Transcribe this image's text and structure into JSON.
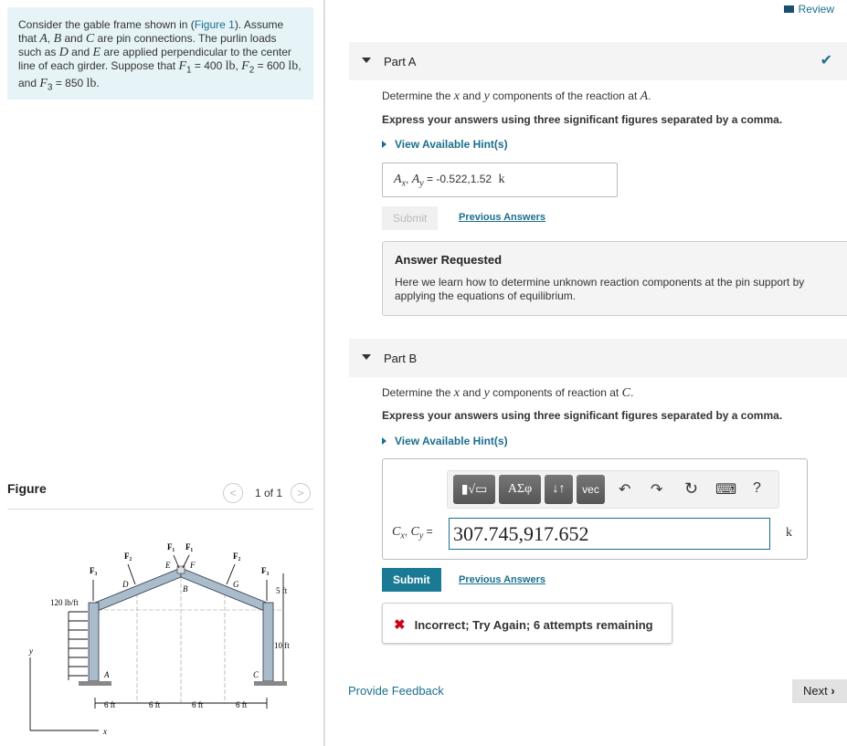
{
  "review": "Review",
  "problem": {
    "p1": "Consider the gable frame shown in (",
    "fig_link": "Figure 1",
    "p2": "). Assume that ",
    "A": "A",
    "B": "B",
    "C": "C",
    "p3": " are pin connections. The purlin loads such as ",
    "D": "D",
    "E": "E",
    "p4": " are applied perpendicular to the center line of each girder. Suppose that ",
    "F1": "F",
    "F1sub": "1",
    "F1val": " = 400 ",
    "unit": "lb",
    "F2": "F",
    "F2sub": "2",
    "F2val": " = 600 ",
    "F3": "F",
    "F3sub": "3",
    "F3val": " = 850 ",
    "and": " and ",
    "comma": ", ",
    "comma_and": ", and "
  },
  "figure": {
    "heading": "Figure",
    "pager": "1 of 1",
    "load": "120 lb/ft",
    "dims": [
      "6 ft",
      "6 ft",
      "6 ft",
      "6 ft"
    ],
    "h1": "5 ft",
    "h2": "10 ft",
    "labels": {
      "A": "A",
      "B": "B",
      "C": "C",
      "D": "D",
      "E": "E",
      "F": "F",
      "G": "G",
      "F1": "F₁",
      "F2": "F₂",
      "F3": "F₃",
      "x": "x",
      "y": "y"
    }
  },
  "partA": {
    "title": "Part A",
    "question_pre": "Determine the ",
    "x": "x",
    "and": " and ",
    "y": "y",
    "question_post": " components of the reaction at ",
    "point": "A",
    "instructions": "Express your answers using three significant figures separated by a comma.",
    "hint": "View Available Hint(s)",
    "answer_label": "A",
    "answer_label2": "A",
    "answer_value": "-0.522,1.52",
    "answer_unit": "k",
    "submit": "Submit",
    "previous": "Previous Answers",
    "requested_title": "Answer Requested",
    "requested_text": "Here we learn how to determine unknown reaction components at the pin support by applying the equations of equilibrium."
  },
  "partB": {
    "title": "Part B",
    "question_pre": "Determine the ",
    "x": "x",
    "and": " and ",
    "y": "y",
    "question_post": " components of reaction at ",
    "point": "C",
    "instructions": "Express your answers using three significant figures separated by a comma.",
    "hint": "View Available Hint(s)",
    "toolbar": {
      "templates": "▮√▭",
      "greek": "ΑΣφ",
      "sort": "↓↑",
      "vec": "vec",
      "undo": "↶",
      "redo": "↷",
      "reset": "↻",
      "keyboard": "⌨",
      "help": "?"
    },
    "answer_label": "C",
    "answer_value": "307.745,917.652",
    "answer_unit": "k",
    "submit": "Submit",
    "previous": "Previous Answers",
    "feedback": "Incorrect; Try Again; 6 attempts remaining"
  },
  "footer": {
    "provide_feedback": "Provide Feedback",
    "next": "Next"
  },
  "colors": {
    "accent": "#1a7a94",
    "error": "#d0021b",
    "success": "#1a6f8e"
  }
}
